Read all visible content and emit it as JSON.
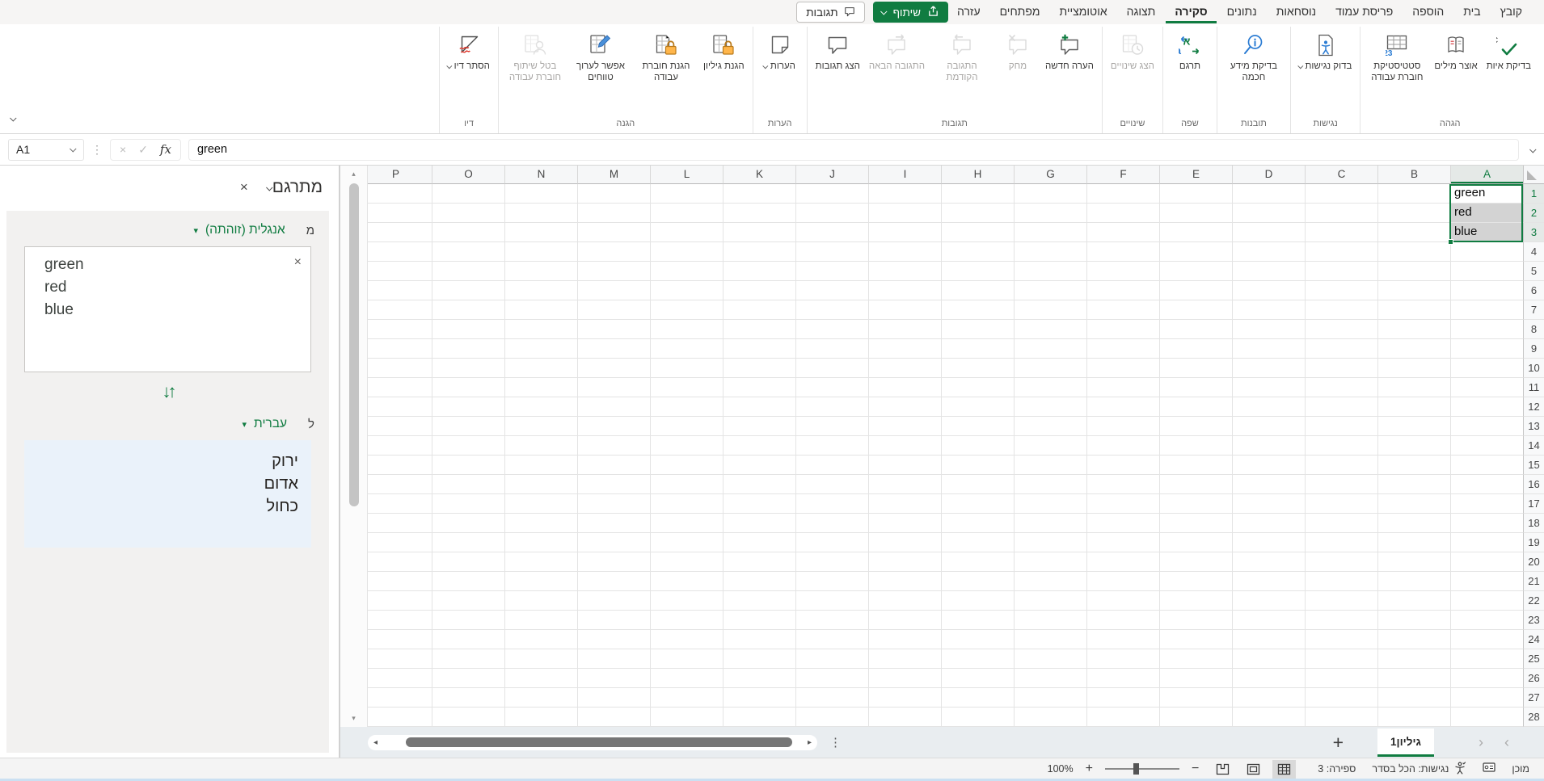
{
  "chrome": {
    "share_label": "שיתוף",
    "comments_label": "תגובות",
    "tabs": [
      {
        "label": "קובץ"
      },
      {
        "label": "בית"
      },
      {
        "label": "הוספה"
      },
      {
        "label": "פריסת עמוד"
      },
      {
        "label": "נוסחאות"
      },
      {
        "label": "נתונים"
      },
      {
        "label": "סקירה",
        "active": true
      },
      {
        "label": "תצוגה"
      },
      {
        "label": "אוטומציית"
      },
      {
        "label": "מפתחים"
      },
      {
        "label": "עזרה"
      }
    ]
  },
  "ribbon": {
    "groups": [
      {
        "label": "הגהה",
        "buttons": [
          {
            "label": "בדיקת איות",
            "icon": "spelling-icon"
          },
          {
            "label": "אוצר מילים",
            "icon": "thesaurus-icon"
          },
          {
            "label": "סטטיסטיקת חוברת עבודה",
            "icon": "workbook-statistics-icon"
          }
        ]
      },
      {
        "label": "נגישות",
        "buttons": [
          {
            "label": "בדוק נגישות",
            "icon": "check-accessibility-icon",
            "chevron": true
          }
        ]
      },
      {
        "label": "תובנות",
        "buttons": [
          {
            "label": "בדיקת מידע חכמה",
            "icon": "smart-lookup-icon"
          }
        ]
      },
      {
        "label": "שפה",
        "buttons": [
          {
            "label": "תרגם",
            "icon": "translate-icon"
          }
        ]
      },
      {
        "label": "שינויים",
        "buttons": [
          {
            "label": "הצג שינויים",
            "icon": "show-changes-icon",
            "disabled": true
          }
        ]
      },
      {
        "label": "תגובות",
        "buttons": [
          {
            "label": "הערה חדשה",
            "icon": "new-comment-icon"
          },
          {
            "label": "מחק",
            "icon": "delete-comment-icon",
            "disabled": true
          },
          {
            "label": "התגובה הקודמת",
            "icon": "previous-comment-icon",
            "disabled": true
          },
          {
            "label": "התגובה הבאה",
            "icon": "next-comment-icon",
            "disabled": true
          },
          {
            "label": "הצג תגובות",
            "icon": "show-comments-icon"
          }
        ]
      },
      {
        "label": "הערות",
        "buttons": [
          {
            "label": "הערות",
            "icon": "notes-icon",
            "chevron": true
          }
        ]
      },
      {
        "label": "הגנה",
        "buttons": [
          {
            "label": "הגנת גיליון",
            "icon": "protect-sheet-icon"
          },
          {
            "label": "הגנת חוברת עבודה",
            "icon": "protect-workbook-icon"
          },
          {
            "label": "אפשר לערוך טווחים",
            "icon": "allow-edit-ranges-icon"
          },
          {
            "label": "בטל שיתוף חוברת עבודה",
            "icon": "unshare-workbook-icon",
            "disabled": true
          }
        ]
      },
      {
        "label": "דיו",
        "buttons": [
          {
            "label": "הסתר דיו",
            "icon": "hide-ink-icon",
            "chevron": true
          }
        ]
      }
    ]
  },
  "formula_bar": {
    "name_box": "A1",
    "fx": "fx",
    "value": "green"
  },
  "translator": {
    "title": "מתרגם",
    "from_label": "מ",
    "from_language": "אנגלית (זוהתה)",
    "source_lines": [
      "green",
      "red",
      "blue"
    ],
    "to_label": "ל",
    "to_language": "עברית",
    "result_lines": [
      "ירוק",
      "אדום",
      "כחול"
    ]
  },
  "grid": {
    "columns": [
      "A",
      "B",
      "C",
      "D",
      "E",
      "F",
      "G",
      "H",
      "I",
      "J",
      "K",
      "L",
      "M",
      "N",
      "O",
      "P"
    ],
    "row_count": 28,
    "cells": [
      {
        "ref": "A1",
        "value": "green",
        "selected": "active"
      },
      {
        "ref": "A2",
        "value": "red",
        "selected": "fill"
      },
      {
        "ref": "A3",
        "value": "blue",
        "selected": "fill"
      }
    ],
    "selection": {
      "range": "A1:A3",
      "col": "A",
      "rows": [
        1,
        2,
        3
      ]
    }
  },
  "sheet_bar": {
    "prev": "‹",
    "next": "›",
    "tab": "גיליון1",
    "add": "+"
  },
  "status_bar": {
    "ready": "מוכן",
    "accessibility": "נגישות: הכל בסדר",
    "count": "ספירה: 3",
    "zoom": "100%",
    "zoom_in": "+",
    "zoom_out": "−"
  },
  "colors": {
    "accent_green": "#107C41",
    "selection_fill": "#D3D3D3",
    "result_box_blue": "#EAF2FA"
  }
}
